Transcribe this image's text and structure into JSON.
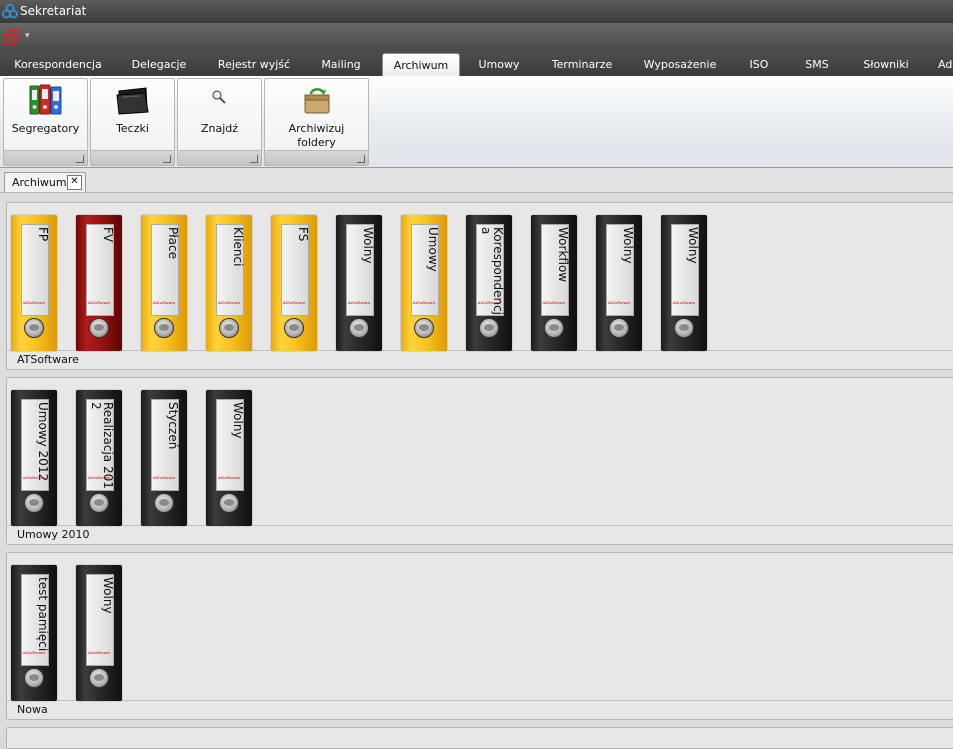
{
  "window": {
    "title": "Sekretariat",
    "accent": "#3a8fd6"
  },
  "quick_access": {
    "icon": "windows-restore-icon",
    "dropdown": "chevron-down-icon"
  },
  "tabs": [
    {
      "label": "Korespondencja"
    },
    {
      "label": "Delegacje"
    },
    {
      "label": "Rejestr wyjść"
    },
    {
      "label": "Mailing"
    },
    {
      "label": "Archiwum",
      "active": true
    },
    {
      "label": "Umowy"
    },
    {
      "label": "Terminarze"
    },
    {
      "label": "Wyposażenie"
    },
    {
      "label": "ISO"
    },
    {
      "label": "SMS"
    },
    {
      "label": "Słowniki"
    },
    {
      "label": "Ad"
    }
  ],
  "ribbon": {
    "groups": [
      {
        "label": "Segregatory",
        "icon": "binders-icon"
      },
      {
        "label": "Teczki",
        "icon": "folder-icon"
      },
      {
        "label": "Znajdź",
        "icon": "magnifier-icon"
      },
      {
        "label": "Archiwizuj foldery Windows",
        "icon": "archive-recycle-icon"
      }
    ]
  },
  "document_tab": {
    "label": "Archiwum",
    "close": "✕"
  },
  "shelves": [
    {
      "name": "ATSoftware",
      "binders": [
        {
          "label": "FP",
          "color": "yellow"
        },
        {
          "label": "FV",
          "color": "red"
        },
        {
          "label": "Płace",
          "color": "yellow"
        },
        {
          "label": "Klienci",
          "color": "yellow"
        },
        {
          "label": "FS",
          "color": "yellow"
        },
        {
          "label": "Wolny",
          "color": "black"
        },
        {
          "label": "Umowy",
          "color": "yellow"
        },
        {
          "label": "Korespondencja",
          "color": "black"
        },
        {
          "label": "Workflow",
          "color": "black"
        },
        {
          "label": "Wolny",
          "color": "black"
        },
        {
          "label": "Wolny",
          "color": "black"
        }
      ]
    },
    {
      "name": "Umowy 2010",
      "binders": [
        {
          "label": "Umowy 2012",
          "color": "black"
        },
        {
          "label": "Realizacja 2012",
          "color": "black"
        },
        {
          "label": "Styczeń",
          "color": "black"
        },
        {
          "label": "Wolny",
          "color": "black"
        }
      ]
    },
    {
      "name": "Nowa",
      "binders": [
        {
          "label": "test pamięci",
          "color": "black"
        },
        {
          "label": "Wolny",
          "color": "black"
        }
      ]
    }
  ],
  "binder_brand": "AtSoftware"
}
